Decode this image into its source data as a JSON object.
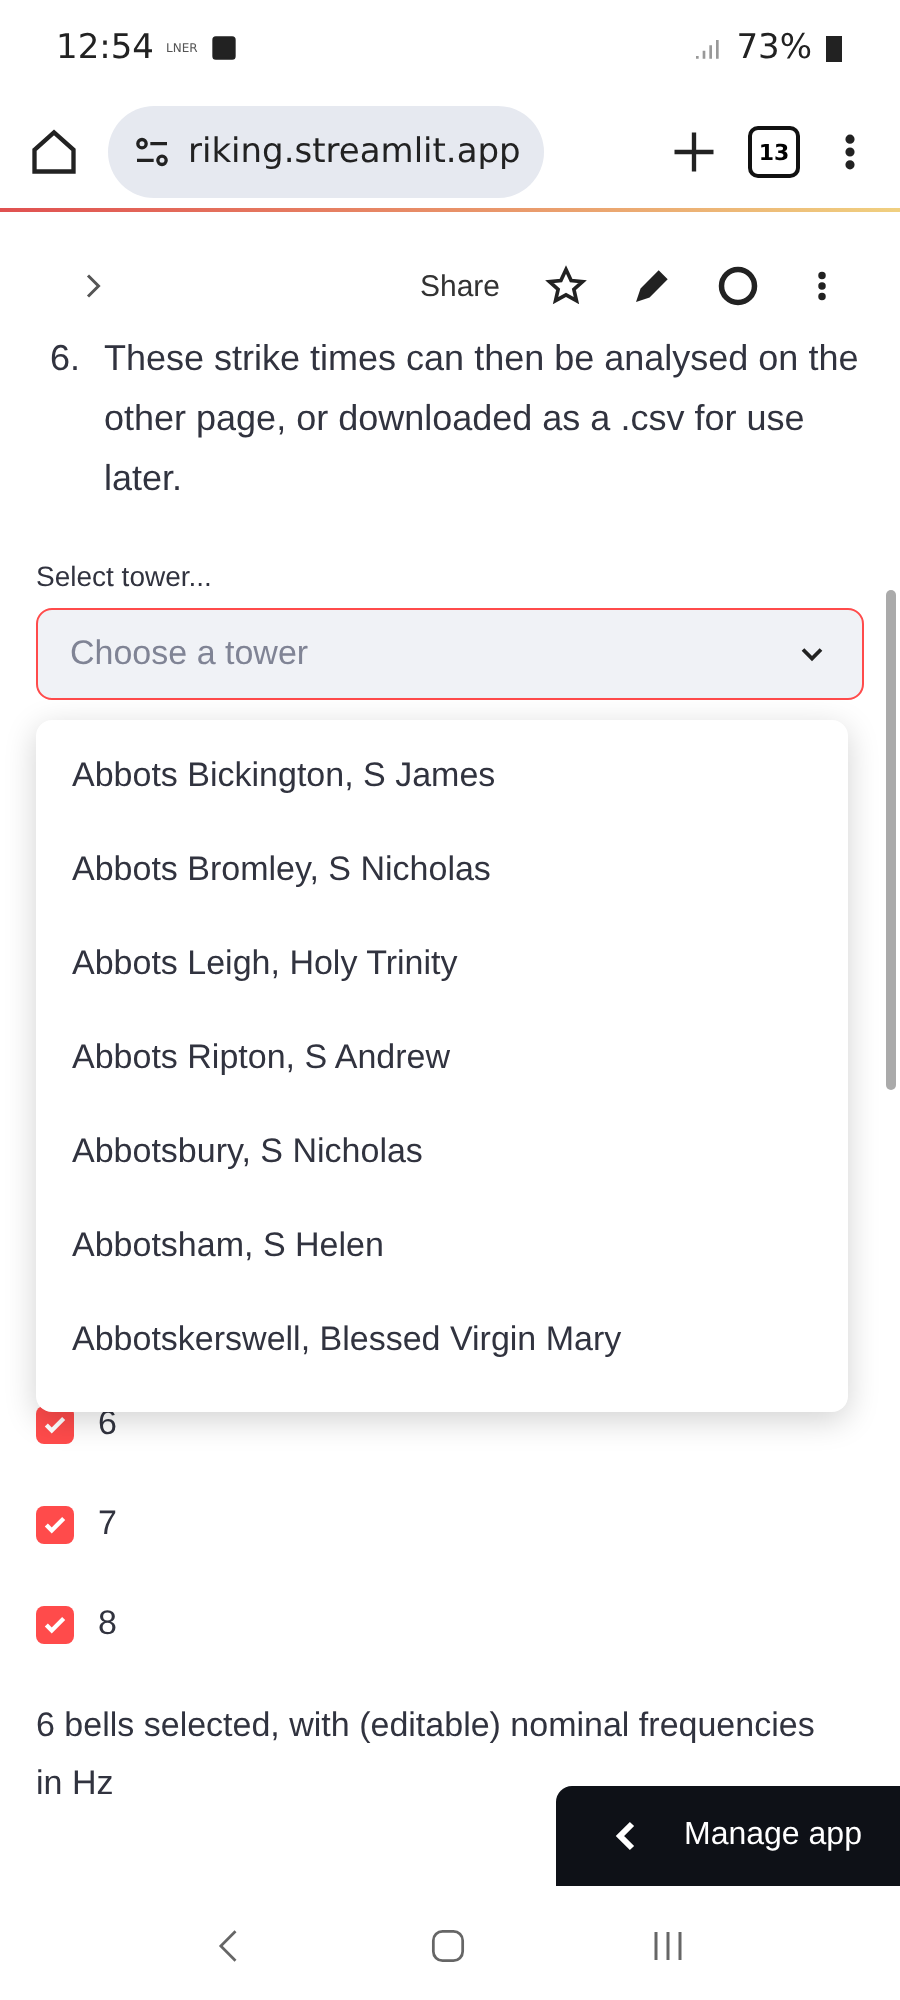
{
  "status_bar": {
    "time": "12:54",
    "carrier": "LNER",
    "battery": "73%"
  },
  "browser": {
    "url": "riking.streamlit.app",
    "tab_count": "13"
  },
  "app_header": {
    "share": "Share"
  },
  "instruction": {
    "number": "6.",
    "text": "These strike times can then be analysed on the other page, or downloaded as a .csv for use later."
  },
  "tower_select": {
    "label": "Select tower...",
    "placeholder": "Choose a tower",
    "expanded": true,
    "options": [
      "Abbots Bickington, S James",
      "Abbots Bromley, S Nicholas",
      "Abbots Leigh, Holy Trinity",
      "Abbots Ripton, S Andrew",
      "Abbotsbury, S Nicholas",
      "Abbotsham, S Helen",
      "Abbotskerswell, Blessed Virgin Mary"
    ]
  },
  "bells": [
    {
      "label": "6",
      "checked": true
    },
    {
      "label": "7",
      "checked": true
    },
    {
      "label": "8",
      "checked": true
    }
  ],
  "summary": "6 bells selected, with (editable) nominal frequencies in Hz",
  "manage_app": "Manage app"
}
